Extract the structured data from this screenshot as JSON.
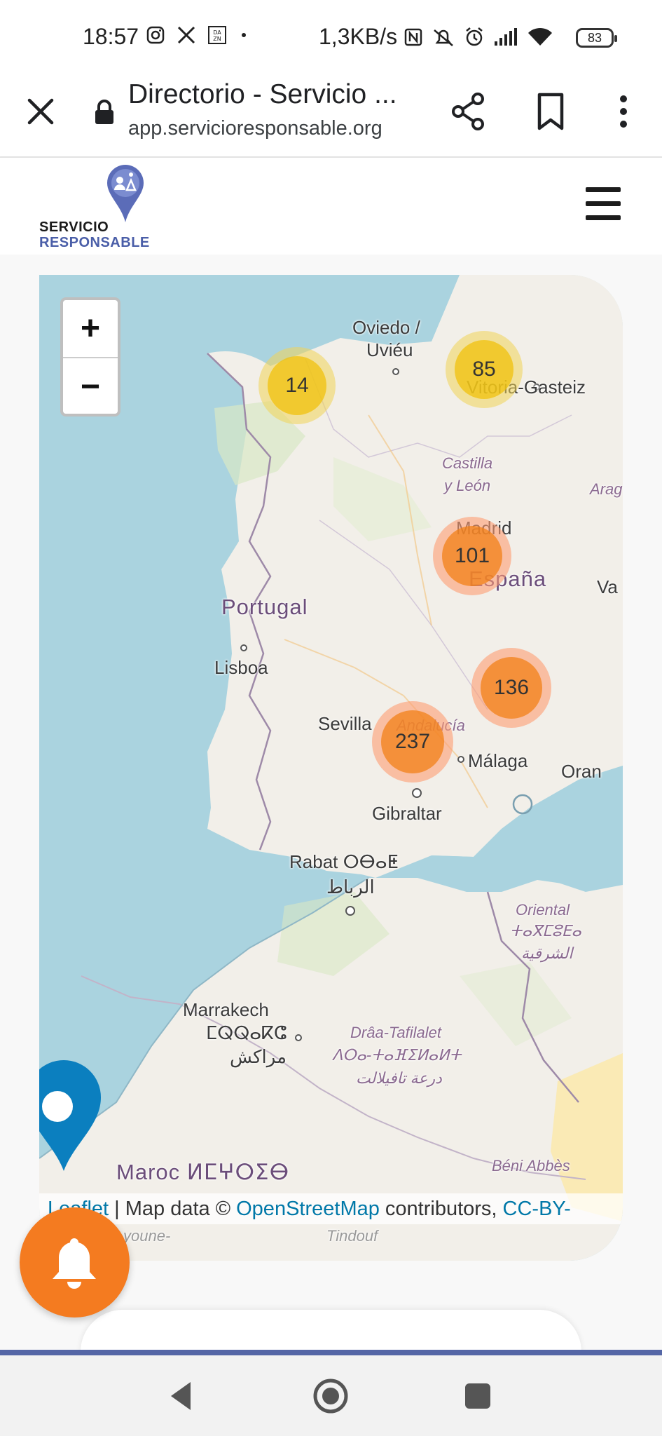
{
  "status_bar": {
    "time": "18:57",
    "network_speed": "1,3KB/s",
    "battery": "83",
    "icons": [
      "instagram-icon",
      "x-icon",
      "dazn-icon",
      "dot-icon",
      "nfc-icon",
      "mute-icon",
      "alarm-icon",
      "signal-icon",
      "wifi-icon",
      "battery-icon"
    ]
  },
  "browser": {
    "page_title": "Directorio - Servicio ...",
    "url": "app.servicioresponsable.org",
    "icons": [
      "close-icon",
      "lock-icon",
      "share-icon",
      "bookmark-icon",
      "more-vert-icon"
    ]
  },
  "site": {
    "logo_line1": "SERVICIO",
    "logo_line2": "RESPONSABLE",
    "menu_icon": "hamburger-icon",
    "accent_color": "#4a5ea8"
  },
  "map": {
    "zoom_in": "+",
    "zoom_out": "−",
    "clusters": [
      {
        "count": "14",
        "color": "yellow"
      },
      {
        "count": "85",
        "color": "yellow"
      },
      {
        "count": "101",
        "color": "orange"
      },
      {
        "count": "136",
        "color": "orange"
      },
      {
        "count": "237",
        "color": "orange"
      }
    ],
    "labels": {
      "oviedo_1": "Oviedo /",
      "oviedo_2": "Uviéu",
      "vitoria": "Vitoria-Gasteiz",
      "castilla_1": "Castilla",
      "castilla_2": "y León",
      "aragon": "Arag",
      "madrid": "Madrid",
      "espana": "España",
      "valencia": "Va",
      "portugal": "Portugal",
      "lisboa": "Lisboa",
      "sevilla": "Sevilla",
      "andalucia": "Andalucía",
      "malaga": "Málaga",
      "oran": "Oran",
      "gibraltar": "Gibraltar",
      "rabat": "Rabat ⵔⴱⴰⵟ",
      "rabat_ar": "الرباط",
      "oriental_1": "Oriental",
      "oriental_2": "ⵜⴰⴳⵎⵓⴹⴰ",
      "oriental_3": "الشرقية",
      "marrakech_1": "Marrakech",
      "marrakech_2": "ⵎⵕⵕⴰⴽⵛ",
      "marrakech_3": "مراكش",
      "draa_1": "Drâa-Tafilalet",
      "draa_2": "ⴷⵔⴰ-ⵜⴰⴼⵉⵍⴰⵍⵜ",
      "draa_3": "درعة تافيلالت",
      "maroc": "Maroc ⵍⵎⵖⵔⵉⴱ",
      "beni_abbes": "Béni Abbès",
      "tindouf": "Tindouf",
      "layoune": "youne-"
    },
    "attribution": {
      "leaflet": "Leaflet",
      "sep": " | Map data © ",
      "osm": "OpenStreetMap",
      "contrib": " contributors, ",
      "license": "CC-BY-"
    }
  },
  "fab": {
    "icon": "bell-icon",
    "color": "#f47b20"
  },
  "navbar": {
    "icons": [
      "back-icon",
      "home-icon",
      "recents-icon"
    ]
  }
}
